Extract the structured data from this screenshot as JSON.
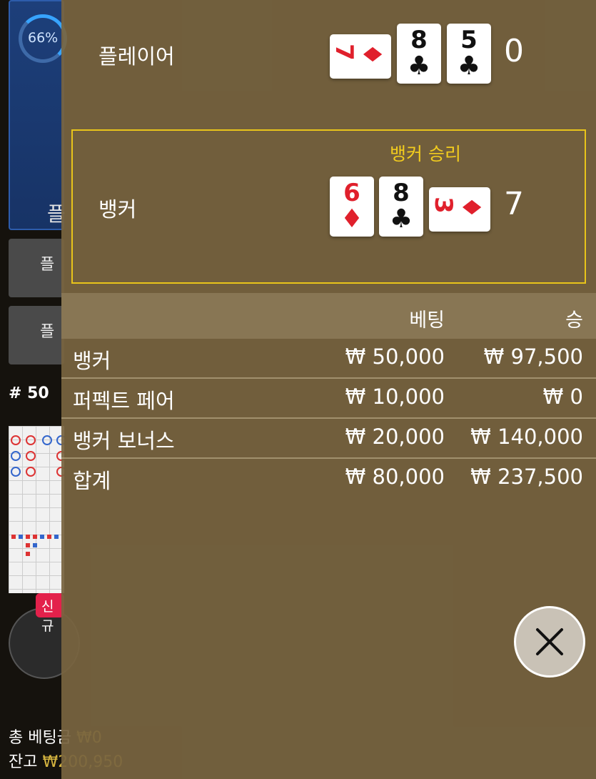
{
  "background": {
    "progress_text": "66%",
    "mini_label": "플",
    "side_btn_1": "플",
    "side_btn_2": "플",
    "round_number": "# 50",
    "new_badge": "신규",
    "total_bet_label": "총 베팅금",
    "total_bet_value": "₩0",
    "balance_label": "잔고",
    "balance_value": "₩200,950"
  },
  "player": {
    "label": "플레이어",
    "score": "0",
    "cards": [
      {
        "rank": "7",
        "suit": "♦",
        "color": "red",
        "orientation": "side"
      },
      {
        "rank": "8",
        "suit": "♣",
        "color": "black",
        "orientation": "upright"
      },
      {
        "rank": "5",
        "suit": "♣",
        "color": "black",
        "orientation": "upright"
      }
    ]
  },
  "banker": {
    "label": "뱅커",
    "score": "7",
    "winner_text": "뱅커 승리",
    "cards": [
      {
        "rank": "6",
        "suit": "♦",
        "color": "red",
        "orientation": "upright"
      },
      {
        "rank": "8",
        "suit": "♣",
        "color": "black",
        "orientation": "upright"
      },
      {
        "rank": "3",
        "suit": "♦",
        "color": "red",
        "orientation": "side"
      }
    ]
  },
  "table": {
    "header_bet": "베팅",
    "header_win": "승",
    "rows": [
      {
        "name": "뱅커",
        "bet": "₩ 50,000",
        "win": "₩ 97,500"
      },
      {
        "name": "퍼펙트 페어",
        "bet": "₩ 10,000",
        "win": "₩ 0"
      },
      {
        "name": "뱅커 보너스",
        "bet": "₩ 20,000",
        "win": "₩ 140,000"
      }
    ],
    "total": {
      "name": "합계",
      "bet": "₩ 80,000",
      "win": "₩ 237,500"
    }
  },
  "colors": {
    "overlay": "#786440",
    "highlight_border": "#e8c41a",
    "winner_text": "#f2cc1e",
    "red_suit": "#e0202c"
  }
}
